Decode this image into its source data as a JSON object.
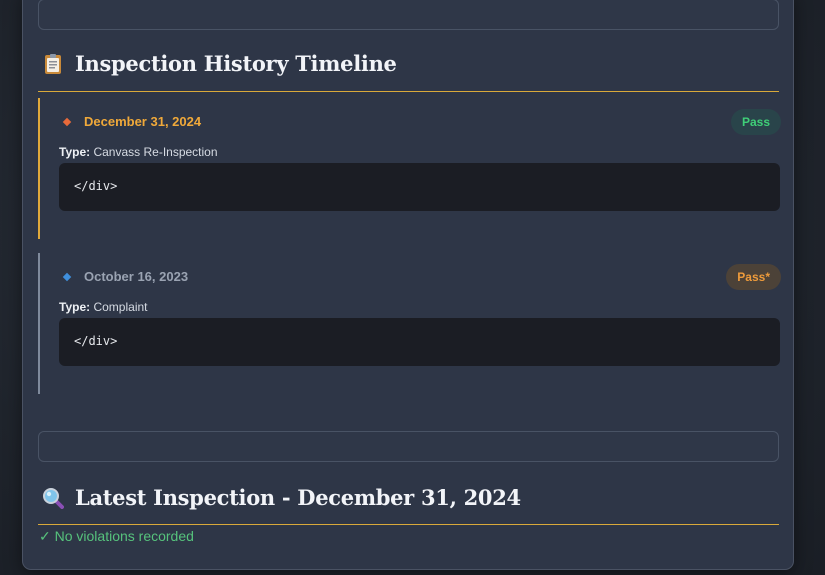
{
  "sections": {
    "history": {
      "icon": "clipboard-icon",
      "title": "Inspection History Timeline"
    },
    "latest": {
      "icon": "magnifier-icon",
      "title": "Latest Inspection - December 31, 2024",
      "status_text": "✓ No violations recorded"
    }
  },
  "timeline": [
    {
      "date": "December 31, 2024",
      "type_label": "Type:",
      "type_value": "Canvass Re-Inspection",
      "result": "Pass",
      "code": "</div>",
      "marker_color": "#e86a3a",
      "date_color": "#f0a93a"
    },
    {
      "date": "October 16, 2023",
      "type_label": "Type:",
      "type_value": "Complaint",
      "result": "Pass*",
      "code": "</div>",
      "marker_color": "#3f8fdc",
      "date_color": "#9aa3b2"
    }
  ],
  "colors": {
    "accent_rule": "#d9a93a",
    "pass_green": "#3fcf78",
    "pass_star_orange": "#ee9b3b"
  }
}
